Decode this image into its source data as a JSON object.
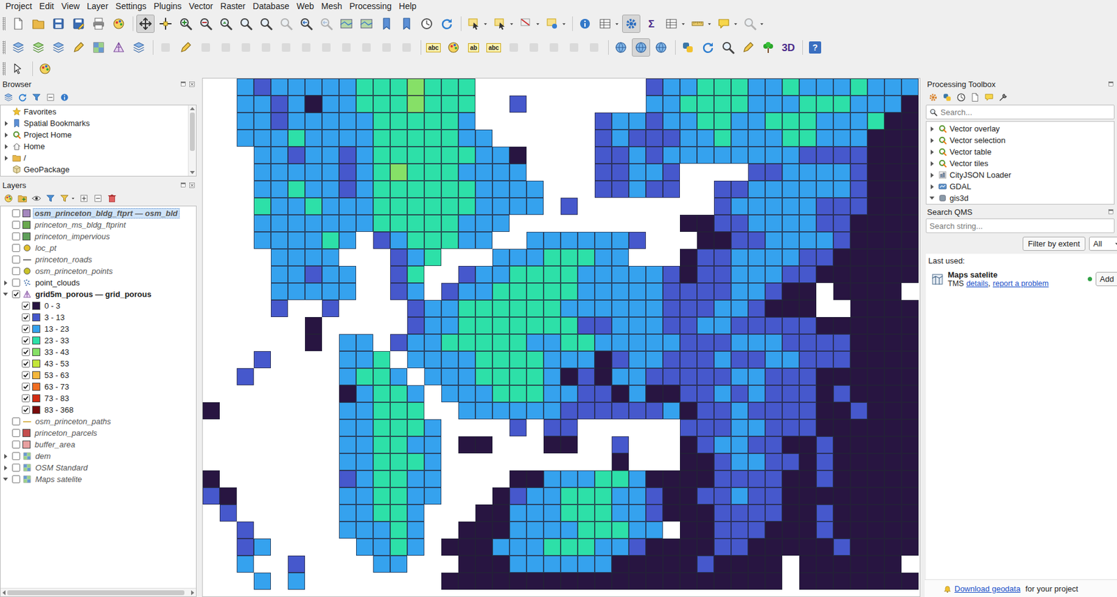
{
  "menu": [
    "Project",
    "Edit",
    "View",
    "Layer",
    "Settings",
    "Plugins",
    "Vector",
    "Raster",
    "Database",
    "Web",
    "Mesh",
    "Processing",
    "Help"
  ],
  "toolbars": [
    [
      {
        "kind": "doc",
        "state": "normal"
      },
      {
        "kind": "folder",
        "state": "normal"
      },
      {
        "kind": "save",
        "state": "normal"
      },
      {
        "kind": "saveas",
        "state": "normal"
      },
      {
        "kind": "print",
        "state": "normal"
      },
      {
        "kind": "palette",
        "state": "normal"
      },
      {
        "kind": "sep"
      },
      {
        "kind": "pan",
        "state": "active"
      },
      {
        "kind": "pansel",
        "state": "normal"
      },
      {
        "kind": "zoomin",
        "state": "normal"
      },
      {
        "kind": "zoomout",
        "state": "normal"
      },
      {
        "kind": "zoomfull",
        "state": "normal"
      },
      {
        "kind": "zoom",
        "state": "normal"
      },
      {
        "kind": "zoom",
        "state": "normal"
      },
      {
        "kind": "zoom",
        "state": "disabled"
      },
      {
        "kind": "zoomlast",
        "state": "normal"
      },
      {
        "kind": "zoomlast",
        "state": "disabled"
      },
      {
        "kind": "map",
        "state": "normal"
      },
      {
        "kind": "map",
        "state": "normal"
      },
      {
        "kind": "bookmark",
        "state": "normal"
      },
      {
        "kind": "bookmark",
        "state": "normal"
      },
      {
        "kind": "clock",
        "state": "normal"
      },
      {
        "kind": "refresh",
        "state": "normal"
      },
      {
        "kind": "sep"
      },
      {
        "kind": "select",
        "state": "normal"
      },
      {
        "kind": "caret"
      },
      {
        "kind": "select",
        "state": "normal"
      },
      {
        "kind": "caret"
      },
      {
        "kind": "deselect",
        "state": "normal"
      },
      {
        "kind": "caret"
      },
      {
        "kind": "selectloc",
        "state": "normal"
      },
      {
        "kind": "caret"
      },
      {
        "kind": "sep"
      },
      {
        "kind": "identify",
        "state": "normal"
      },
      {
        "kind": "table",
        "state": "normal"
      },
      {
        "kind": "caret"
      },
      {
        "kind": "gear",
        "state": "active"
      },
      {
        "kind": "text",
        "glyph": "Σ",
        "state": "normal"
      },
      {
        "kind": "table",
        "state": "normal"
      },
      {
        "kind": "caret"
      },
      {
        "kind": "ruler",
        "state": "normal"
      },
      {
        "kind": "caret"
      },
      {
        "kind": "tip",
        "state": "normal"
      },
      {
        "kind": "caret"
      },
      {
        "kind": "zoom",
        "state": "disabled"
      },
      {
        "kind": "caret"
      }
    ],
    [
      {
        "kind": "layer",
        "state": "normal"
      },
      {
        "kind": "vector",
        "state": "normal"
      },
      {
        "kind": "layer",
        "state": "normal"
      },
      {
        "kind": "pencil",
        "state": "normal"
      },
      {
        "kind": "raster",
        "state": "normal"
      },
      {
        "kind": "mesh",
        "state": "normal"
      },
      {
        "kind": "layer",
        "state": "normal"
      },
      {
        "kind": "sep"
      },
      {
        "kind": "edit",
        "state": "disabled"
      },
      {
        "kind": "pencil",
        "state": "normal"
      },
      {
        "kind": "edit",
        "state": "disabled"
      },
      {
        "kind": "edit",
        "state": "disabled"
      },
      {
        "kind": "edit",
        "state": "disabled"
      },
      {
        "kind": "edit",
        "state": "disabled"
      },
      {
        "kind": "edit",
        "state": "disabled"
      },
      {
        "kind": "edit",
        "state": "disabled"
      },
      {
        "kind": "edit",
        "state": "disabled"
      },
      {
        "kind": "edit",
        "state": "disabled"
      },
      {
        "kind": "edit",
        "state": "disabled"
      },
      {
        "kind": "edit",
        "state": "disabled"
      },
      {
        "kind": "edit",
        "state": "disabled"
      },
      {
        "kind": "sep"
      },
      {
        "kind": "label",
        "glyph": "abc",
        "state": "normal"
      },
      {
        "kind": "palette",
        "state": "normal"
      },
      {
        "kind": "label",
        "glyph": "ab",
        "state": "normal"
      },
      {
        "kind": "label",
        "glyph": "abc",
        "state": "normal"
      },
      {
        "kind": "edit",
        "state": "disabled"
      },
      {
        "kind": "edit",
        "state": "disabled"
      },
      {
        "kind": "edit",
        "state": "disabled"
      },
      {
        "kind": "edit",
        "state": "disabled"
      },
      {
        "kind": "edit",
        "state": "disabled"
      },
      {
        "kind": "sep"
      },
      {
        "kind": "globe",
        "state": "normal"
      },
      {
        "kind": "globe",
        "state": "active"
      },
      {
        "kind": "globe",
        "state": "normal"
      },
      {
        "kind": "sep"
      },
      {
        "kind": "python",
        "state": "normal"
      },
      {
        "kind": "refresh",
        "state": "normal"
      },
      {
        "kind": "zoom",
        "state": "normal"
      },
      {
        "kind": "pencil",
        "state": "normal"
      },
      {
        "kind": "tree",
        "state": "normal"
      },
      {
        "kind": "text",
        "glyph": "3D",
        "state": "normal"
      },
      {
        "kind": "sep"
      },
      {
        "kind": "help",
        "glyph": "?",
        "state": "normal"
      }
    ],
    [
      {
        "kind": "cursor",
        "state": "normal"
      },
      {
        "kind": "sep"
      },
      {
        "kind": "palette",
        "state": "normal"
      }
    ]
  ],
  "browser": {
    "title": "Browser",
    "tools": [
      {
        "kind": "layer"
      },
      {
        "kind": "refresh"
      },
      {
        "kind": "filter"
      },
      {
        "kind": "collapse"
      },
      {
        "kind": "info"
      }
    ],
    "items": [
      {
        "label": "Favorites",
        "icon": "star",
        "expandable": false,
        "expanded": false
      },
      {
        "label": "Spatial Bookmarks",
        "icon": "bookmark",
        "expandable": true,
        "expanded": false
      },
      {
        "label": "Project Home",
        "icon": "project",
        "expandable": true,
        "expanded": false
      },
      {
        "label": "Home",
        "icon": "home",
        "expandable": true,
        "expanded": false
      },
      {
        "label": "/",
        "icon": "folder",
        "expandable": true,
        "expanded": false
      },
      {
        "label": "GeoPackage",
        "icon": "geopackage",
        "expandable": false,
        "expanded": false
      }
    ]
  },
  "layers": {
    "title": "Layers",
    "tools": [
      {
        "kind": "palette"
      },
      {
        "kind": "addgroup"
      },
      {
        "kind": "eye"
      },
      {
        "kind": "filter"
      },
      {
        "kind": "filterexpr"
      },
      {
        "kind": "caret"
      },
      {
        "kind": "expand"
      },
      {
        "kind": "collapse"
      },
      {
        "kind": "remove"
      }
    ],
    "items": [
      {
        "kind": "layer",
        "label": "osm_princeton_bldg_ftprt — osm_bld",
        "symbol": "fill",
        "color": "#a487be",
        "checked": false,
        "dimmed": true,
        "selected": true,
        "expandable": false,
        "expanded": false
      },
      {
        "kind": "layer",
        "label": "princeton_ms_bldg_ftprint",
        "symbol": "fill",
        "color": "#6aa84f",
        "checked": false,
        "dimmed": true,
        "selected": false,
        "expandable": false,
        "expanded": false
      },
      {
        "kind": "layer",
        "label": "princeton_impervious",
        "symbol": "fill",
        "color": "#5fa05a",
        "checked": false,
        "dimmed": true,
        "selected": false,
        "expandable": false,
        "expanded": false
      },
      {
        "kind": "layer",
        "label": "loc_pt",
        "symbol": "point",
        "color": "#e3c12f",
        "checked": false,
        "dimmed": true,
        "selected": false,
        "expandable": false,
        "expanded": false
      },
      {
        "kind": "layer",
        "label": "princeton_roads",
        "symbol": "line",
        "color": "#7a7a7a",
        "checked": false,
        "dimmed": true,
        "selected": false,
        "expandable": false,
        "expanded": false
      },
      {
        "kind": "layer",
        "label": "osm_princeton_points",
        "symbol": "point",
        "color": "#c9c32a",
        "checked": false,
        "dimmed": true,
        "selected": false,
        "expandable": false,
        "expanded": false
      },
      {
        "kind": "group",
        "label": "point_clouds",
        "symbol": "pointcloud",
        "checked": false,
        "dimmed": false,
        "selected": false,
        "expandable": true,
        "expanded": false
      },
      {
        "kind": "layer",
        "label": "grid5m_porous — grid_porous",
        "symbol": "vector",
        "checked": true,
        "dimmed": false,
        "selected": false,
        "expandable": true,
        "expanded": true
      },
      {
        "kind": "class",
        "label": "0 - 3",
        "symbol": "fill",
        "color": "#281541",
        "checked": true,
        "dimmed": false,
        "selected": false,
        "expandable": false,
        "expanded": false
      },
      {
        "kind": "class",
        "label": "3 - 13",
        "symbol": "fill",
        "color": "#4658cc",
        "checked": true,
        "dimmed": false,
        "selected": false,
        "expandable": false,
        "expanded": false
      },
      {
        "kind": "class",
        "label": "13 - 23",
        "symbol": "fill",
        "color": "#35a2ee",
        "checked": true,
        "dimmed": false,
        "selected": false,
        "expandable": false,
        "expanded": false
      },
      {
        "kind": "class",
        "label": "23 - 33",
        "symbol": "fill",
        "color": "#2de0a8",
        "checked": true,
        "dimmed": false,
        "selected": false,
        "expandable": false,
        "expanded": false
      },
      {
        "kind": "class",
        "label": "33 - 43",
        "symbol": "fill",
        "color": "#86e067",
        "checked": true,
        "dimmed": false,
        "selected": false,
        "expandable": false,
        "expanded": false
      },
      {
        "kind": "class",
        "label": "43 - 53",
        "symbol": "fill",
        "color": "#c3e63a",
        "checked": true,
        "dimmed": false,
        "selected": false,
        "expandable": false,
        "expanded": false
      },
      {
        "kind": "class",
        "label": "53 - 63",
        "symbol": "fill",
        "color": "#f4b63c",
        "checked": true,
        "dimmed": false,
        "selected": false,
        "expandable": false,
        "expanded": false
      },
      {
        "kind": "class",
        "label": "63 - 73",
        "symbol": "fill",
        "color": "#f06e22",
        "checked": true,
        "dimmed": false,
        "selected": false,
        "expandable": false,
        "expanded": false
      },
      {
        "kind": "class",
        "label": "73 - 83",
        "symbol": "fill",
        "color": "#d22c14",
        "checked": true,
        "dimmed": false,
        "selected": false,
        "expandable": false,
        "expanded": false
      },
      {
        "kind": "class",
        "label": "83 - 368",
        "symbol": "fill",
        "color": "#7a0d0d",
        "checked": true,
        "dimmed": false,
        "selected": false,
        "expandable": false,
        "expanded": false
      },
      {
        "kind": "layer",
        "label": "osm_princeton_paths",
        "symbol": "line",
        "color": "#d9b95a",
        "checked": false,
        "dimmed": true,
        "selected": false,
        "expandable": false,
        "expanded": false
      },
      {
        "kind": "layer",
        "label": "princeton_parcels",
        "symbol": "fill",
        "color": "#c44e4e",
        "checked": false,
        "dimmed": true,
        "selected": false,
        "expandable": false,
        "expanded": false
      },
      {
        "kind": "layer",
        "label": "buffer_area",
        "symbol": "fill",
        "color": "#e8a0a0",
        "checked": false,
        "dimmed": true,
        "selected": false,
        "expandable": false,
        "expanded": false
      },
      {
        "kind": "layer",
        "label": "dem",
        "symbol": "raster",
        "checked": false,
        "dimmed": true,
        "selected": false,
        "expandable": true,
        "expanded": false
      },
      {
        "kind": "layer",
        "label": "OSM Standard",
        "symbol": "raster",
        "checked": false,
        "dimmed": true,
        "selected": false,
        "expandable": true,
        "expanded": false
      },
      {
        "kind": "layer",
        "label": "Maps satelite",
        "symbol": "raster",
        "checked": false,
        "dimmed": true,
        "selected": false,
        "expandable": true,
        "expanded": true
      }
    ]
  },
  "map": {
    "rows": [
      "..21222223334333..........1223332232223222",
      "..22120223334333..1.......2233332223332220",
      "..22122222333332.......1221223322333222300",
      "..222322223333322......1211122322233222000",
      "...2212212333333220....1121222222221111000",
      "...2222212343332222....11221....1122221000",
      "...22322123333332222...11211..112222221000",
      "...32232223333332222.1........122222111000",
      "...222222233333222..........00112222110000",
      "...222232.1233322..2222221...0011222210000",
      "....2222...123...22233322...01122221100000",
      "....22122..13..122333322222101122211000000",
      "....22222..12.1223333322222111122100.0000.",
      "....1..1....122333333222222111221000..0000",
      "......0.....122333333311222112211111000000",
      "......0.22.1223333322332222211122211110000",
      "...1....223.222233332220122111211221110000",
      "..1.....2332.22233332010221111122111000000",
      "........02332.2223332211020011212111010000",
      "0.......22333..222222111111201121111001000",
      "........223332....1.11......11122111000000",
      "........223322.00...00..1...01221100100000",
      "........223332..........0...00122110100000",
      "0.......123322....002223320000111100100000",
      "10......223322...0122333221001121100000000",
      ".1......22332...00222333221000111100100000",
      "..1.....22232..000222233322.00111000100000",
      "..12.....2232.0002223332210000110000010000",
      "..2..1....22...0002222220000010000.000000",
      "...2.2........00000000000000000000.0000000"
    ]
  },
  "processing": {
    "title": "Processing Toolbox",
    "tools": [
      {
        "kind": "gears"
      },
      {
        "kind": "python"
      },
      {
        "kind": "clock"
      },
      {
        "kind": "doc"
      },
      {
        "kind": "tip"
      },
      {
        "kind": "wrench"
      }
    ],
    "search": {
      "placeholder": "Search..."
    },
    "items": [
      {
        "label": "Vector overlay",
        "icon": "qgis",
        "expanded": false
      },
      {
        "label": "Vector selection",
        "icon": "qgis",
        "expanded": false
      },
      {
        "label": "Vector table",
        "icon": "qgis",
        "expanded": false
      },
      {
        "label": "Vector tiles",
        "icon": "qgis",
        "expanded": false
      },
      {
        "label": "CityJSON Loader",
        "icon": "cityjson",
        "expanded": false
      },
      {
        "label": "GDAL",
        "icon": "gdal",
        "expanded": false
      },
      {
        "label": "gis3d",
        "icon": "plugin",
        "expanded": true
      }
    ]
  },
  "qms": {
    "title": "Search QMS",
    "search": {
      "placeholder": "Search string..."
    },
    "filter_button": "Filter by extent",
    "dropdown": "All",
    "last_used_label": "Last used:",
    "entries": [
      {
        "name": "Maps satelite",
        "type": "TMS",
        "links": [
          "details",
          "report a problem"
        ],
        "separator": ",",
        "status_color": "#2ea043",
        "add_button": "Add"
      }
    ]
  },
  "footer": {
    "link": "Download geodata",
    "text": "for your project"
  }
}
